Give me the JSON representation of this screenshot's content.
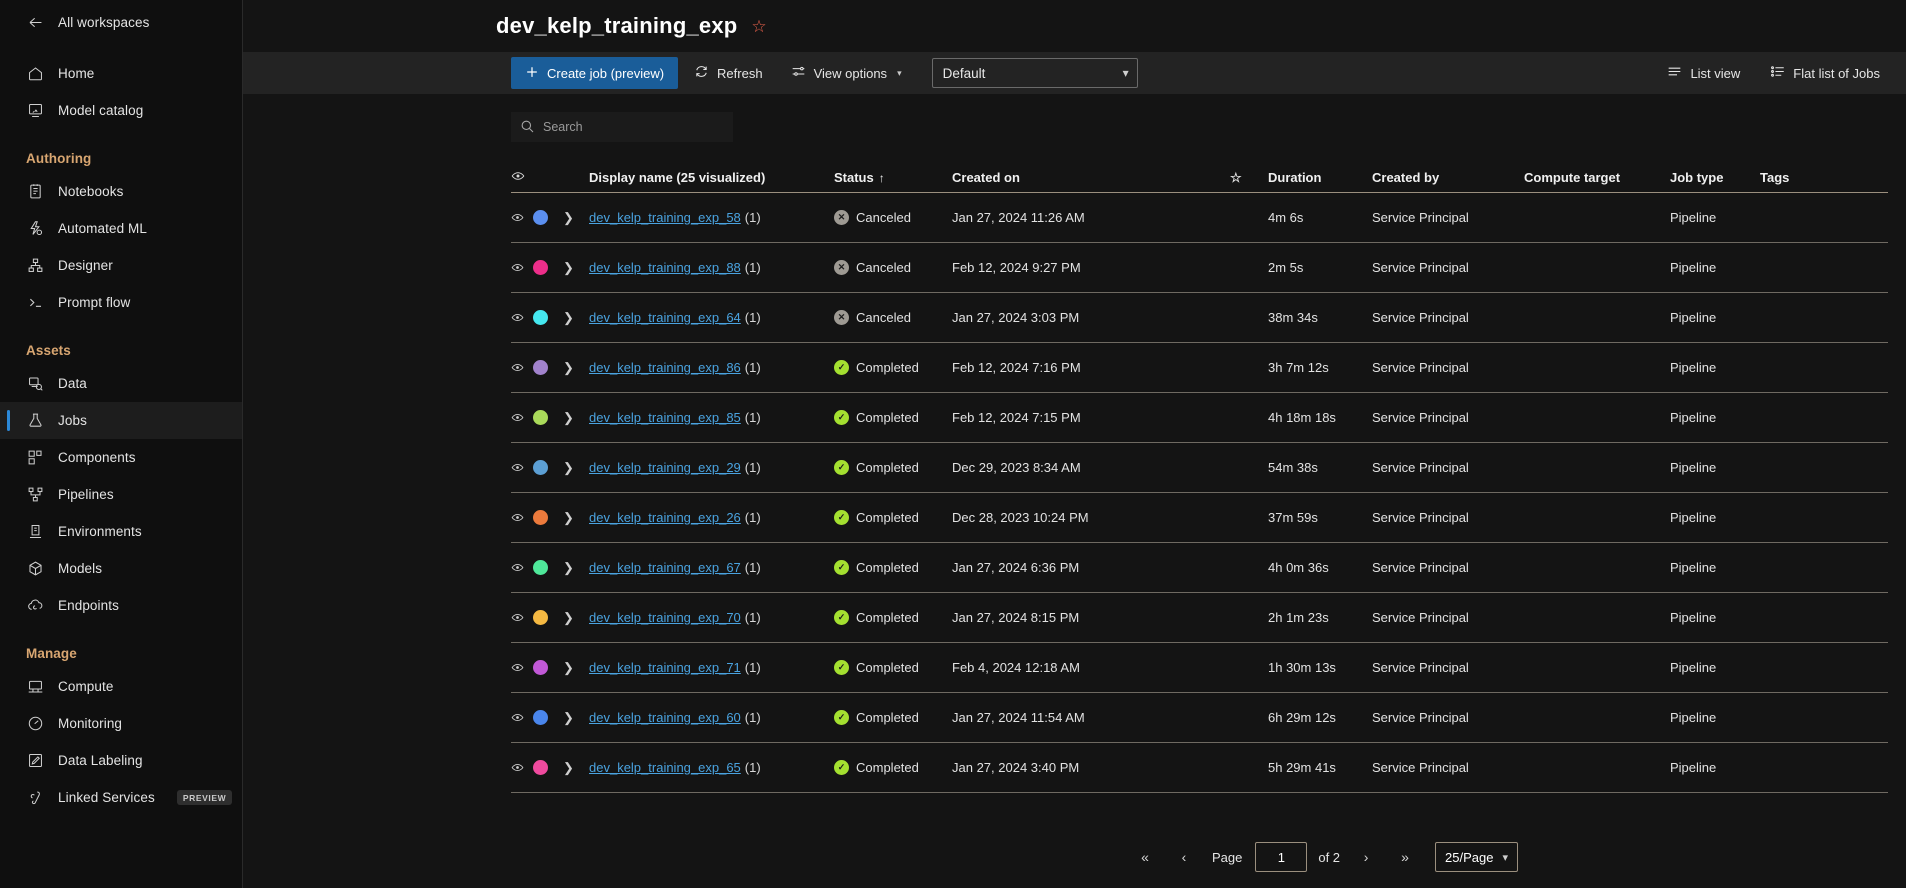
{
  "sidebar": {
    "back": {
      "label": "All workspaces",
      "icon": "arrow-left-icon"
    },
    "top_items": [
      {
        "label": "Home",
        "icon": "home-icon"
      },
      {
        "label": "Model catalog",
        "icon": "model-catalog-icon"
      }
    ],
    "sections": [
      {
        "header": "Authoring",
        "items": [
          {
            "label": "Notebooks",
            "icon": "notebook-icon"
          },
          {
            "label": "Automated ML",
            "icon": "automated-ml-icon"
          },
          {
            "label": "Designer",
            "icon": "designer-icon"
          },
          {
            "label": "Prompt flow",
            "icon": "terminal-icon"
          }
        ]
      },
      {
        "header": "Assets",
        "items": [
          {
            "label": "Data",
            "icon": "data-icon"
          },
          {
            "label": "Jobs",
            "icon": "flask-icon",
            "active": true
          },
          {
            "label": "Components",
            "icon": "components-icon"
          },
          {
            "label": "Pipelines",
            "icon": "pipelines-icon"
          },
          {
            "label": "Environments",
            "icon": "environments-icon"
          },
          {
            "label": "Models",
            "icon": "cube-icon"
          },
          {
            "label": "Endpoints",
            "icon": "endpoints-icon"
          }
        ]
      },
      {
        "header": "Manage",
        "items": [
          {
            "label": "Compute",
            "icon": "compute-icon"
          },
          {
            "label": "Monitoring",
            "icon": "gauge-icon"
          },
          {
            "label": "Data Labeling",
            "icon": "pencil-square-icon"
          },
          {
            "label": "Linked Services",
            "icon": "link-icon",
            "badge": "PREVIEW"
          }
        ]
      }
    ]
  },
  "header": {
    "title": "dev_kelp_training_exp",
    "favorite_icon": "star-icon"
  },
  "toolbar": {
    "create_job_label": "Create job (preview)",
    "refresh_label": "Refresh",
    "view_options_label": "View options",
    "view_select_value": "Default",
    "list_view_label": "List view",
    "flat_list_label": "Flat list of Jobs"
  },
  "search": {
    "placeholder": "Search",
    "value": ""
  },
  "table": {
    "columns": [
      {
        "key": "display_name",
        "label": "Display name (25 visualized)",
        "sort": ""
      },
      {
        "key": "status",
        "label": "Status",
        "sort": "↑"
      },
      {
        "key": "created_on",
        "label": "Created on",
        "sort": ""
      },
      {
        "key": "favorite",
        "label": "",
        "sort": ""
      },
      {
        "key": "duration",
        "label": "Duration",
        "sort": ""
      },
      {
        "key": "created_by",
        "label": "Created by",
        "sort": ""
      },
      {
        "key": "compute_target",
        "label": "Compute target",
        "sort": ""
      },
      {
        "key": "job_type",
        "label": "Job type",
        "sort": ""
      },
      {
        "key": "tags",
        "label": "Tags",
        "sort": ""
      }
    ],
    "rows": [
      {
        "dot": "#5b8ff0",
        "name": "dev_kelp_training_exp_58",
        "count": "(1)",
        "status": "Canceled",
        "status_kind": "canceled",
        "created_on": "Jan 27, 2024 11:26 AM",
        "duration": "4m 6s",
        "created_by": "Service Principal",
        "compute_target": "",
        "job_type": "Pipeline",
        "tags": ""
      },
      {
        "dot": "#ed2e8a",
        "name": "dev_kelp_training_exp_88",
        "count": "(1)",
        "status": "Canceled",
        "status_kind": "canceled",
        "created_on": "Feb 12, 2024 9:27 PM",
        "duration": "2m 5s",
        "created_by": "Service Principal",
        "compute_target": "",
        "job_type": "Pipeline",
        "tags": ""
      },
      {
        "dot": "#45e8f0",
        "name": "dev_kelp_training_exp_64",
        "count": "(1)",
        "status": "Canceled",
        "status_kind": "canceled",
        "created_on": "Jan 27, 2024 3:03 PM",
        "duration": "38m 34s",
        "created_by": "Service Principal",
        "compute_target": "",
        "job_type": "Pipeline",
        "tags": ""
      },
      {
        "dot": "#a182cc",
        "name": "dev_kelp_training_exp_86",
        "count": "(1)",
        "status": "Completed",
        "status_kind": "completed",
        "created_on": "Feb 12, 2024 7:16 PM",
        "duration": "3h 7m 12s",
        "created_by": "Service Principal",
        "compute_target": "",
        "job_type": "Pipeline",
        "tags": ""
      },
      {
        "dot": "#aada5a",
        "name": "dev_kelp_training_exp_85",
        "count": "(1)",
        "status": "Completed",
        "status_kind": "completed",
        "created_on": "Feb 12, 2024 7:15 PM",
        "duration": "4h 18m 18s",
        "created_by": "Service Principal",
        "compute_target": "",
        "job_type": "Pipeline",
        "tags": ""
      },
      {
        "dot": "#5c9fd4",
        "name": "dev_kelp_training_exp_29",
        "count": "(1)",
        "status": "Completed",
        "status_kind": "completed",
        "created_on": "Dec 29, 2023 8:34 AM",
        "duration": "54m 38s",
        "created_by": "Service Principal",
        "compute_target": "",
        "job_type": "Pipeline",
        "tags": ""
      },
      {
        "dot": "#ec7a3c",
        "name": "dev_kelp_training_exp_26",
        "count": "(1)",
        "status": "Completed",
        "status_kind": "completed",
        "created_on": "Dec 28, 2023 10:24 PM",
        "duration": "37m 59s",
        "created_by": "Service Principal",
        "compute_target": "",
        "job_type": "Pipeline",
        "tags": ""
      },
      {
        "dot": "#4fe89a",
        "name": "dev_kelp_training_exp_67",
        "count": "(1)",
        "status": "Completed",
        "status_kind": "completed",
        "created_on": "Jan 27, 2024 6:36 PM",
        "duration": "4h 0m 36s",
        "created_by": "Service Principal",
        "compute_target": "",
        "job_type": "Pipeline",
        "tags": ""
      },
      {
        "dot": "#f5b942",
        "name": "dev_kelp_training_exp_70",
        "count": "(1)",
        "status": "Completed",
        "status_kind": "completed",
        "created_on": "Jan 27, 2024 8:15 PM",
        "duration": "2h 1m 23s",
        "created_by": "Service Principal",
        "compute_target": "",
        "job_type": "Pipeline",
        "tags": ""
      },
      {
        "dot": "#c158d6",
        "name": "dev_kelp_training_exp_71",
        "count": "(1)",
        "status": "Completed",
        "status_kind": "completed",
        "created_on": "Feb 4, 2024 12:18 AM",
        "duration": "1h 30m 13s",
        "created_by": "Service Principal",
        "compute_target": "",
        "job_type": "Pipeline",
        "tags": ""
      },
      {
        "dot": "#4a86ec",
        "name": "dev_kelp_training_exp_60",
        "count": "(1)",
        "status": "Completed",
        "status_kind": "completed",
        "created_on": "Jan 27, 2024 11:54 AM",
        "duration": "6h 29m 12s",
        "created_by": "Service Principal",
        "compute_target": "",
        "job_type": "Pipeline",
        "tags": ""
      },
      {
        "dot": "#f04a9e",
        "name": "dev_kelp_training_exp_65",
        "count": "(1)",
        "status": "Completed",
        "status_kind": "completed",
        "created_on": "Jan 27, 2024 3:40 PM",
        "duration": "5h 29m 41s",
        "created_by": "Service Principal",
        "compute_target": "",
        "job_type": "Pipeline",
        "tags": ""
      }
    ],
    "status_glyphs": {
      "canceled": "✕",
      "completed": "✓"
    }
  },
  "pagination": {
    "first_icon": "«",
    "prev_icon": "‹",
    "page_label": "Page",
    "page_value": "1",
    "of_label": "of 2",
    "next_icon": "›",
    "last_icon": "»",
    "page_size": "25/Page"
  }
}
